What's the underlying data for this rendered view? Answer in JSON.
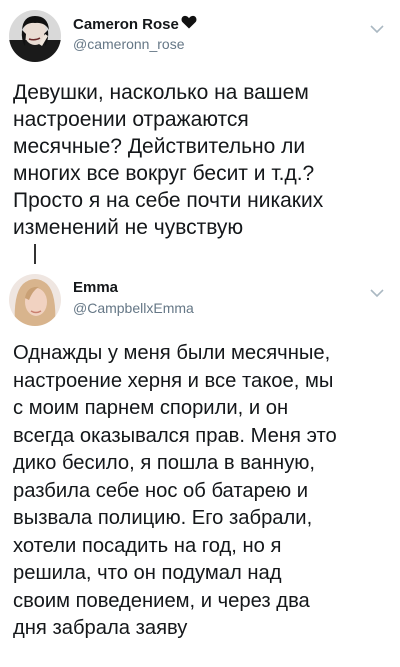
{
  "tweets": [
    {
      "name": "Cameron Rose",
      "handle": "@cameronn_rose",
      "text": "Девушки, насколько на вашем\nнастроении отражаются\nмесячные? Действительно ли\nмногих все вокруг бесит и т.д.?\nПросто я на себе почти никаких\nизменений не чувствую",
      "name_emoji": "black-heart-icon"
    },
    {
      "name": "Emma",
      "handle": "@CampbellxEmma",
      "text": "Однажды у меня были месячные,\nнастроение херня и все такое, мы\nс моим парнем спорили, и он\nвсегда оказывался прав. Меня это\nдико бесило, я пошла в ванную,\nразбила себе нос об батарею и\nвызвала полицию. Его забрали,\nхотели посадить на год, но я\nрешила, что он подумал над\nсвоим поведением, и через два\nдня забрала заяву"
    }
  ],
  "colors": {
    "text": "#14171a",
    "secondary": "#657786",
    "chevron": "#aab8c2"
  }
}
